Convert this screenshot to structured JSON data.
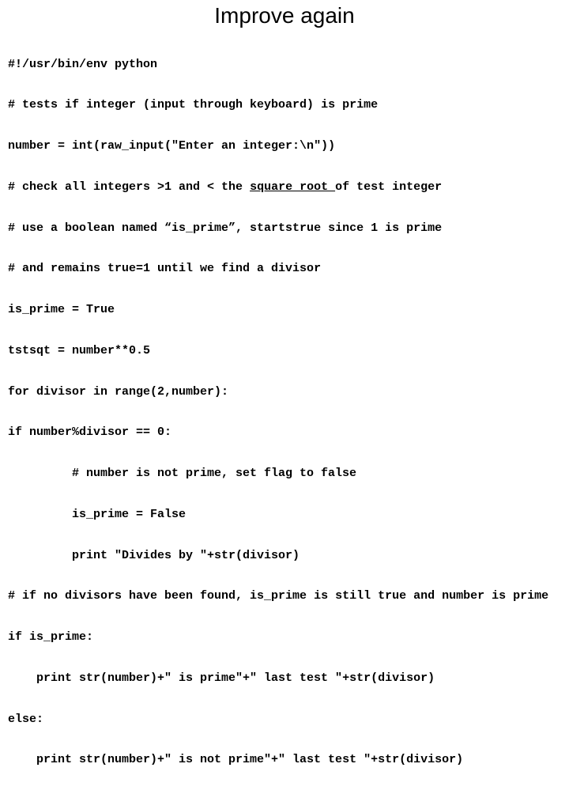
{
  "title": "Improve again",
  "code": {
    "l1": "#!/usr/bin/env python",
    "l2": "# tests if integer (input through keyboard) is prime",
    "l3": "number = int(raw_input(\"Enter an integer:\\n\"))",
    "l4a": "# check all integers >1 and < the ",
    "l4b": "square root ",
    "l4c": "of test integer",
    "l5": "# use a boolean named “is_prime”, startstrue since 1 is prime",
    "l6": "# and remains true=1 until we find a divisor",
    "l7": "is_prime = True",
    "l8": "tstsqt = number**0.5",
    "l9": "for divisor in range(2,number):",
    "l10": "if number%divisor == 0:",
    "l11": "# number is not prime, set flag to false",
    "l12": "is_prime = False",
    "l13": "print \"Divides by \"+str(divisor)",
    "l14": "# if no divisors have been found, is_prime is still true and number is prime",
    "l15": "if is_prime:",
    "l16": "print str(number)+\" is prime\"+\" last test \"+str(divisor)",
    "l17": "else:",
    "l18": "print str(number)+\" is not prime\"+\" last test \"+str(divisor)"
  }
}
